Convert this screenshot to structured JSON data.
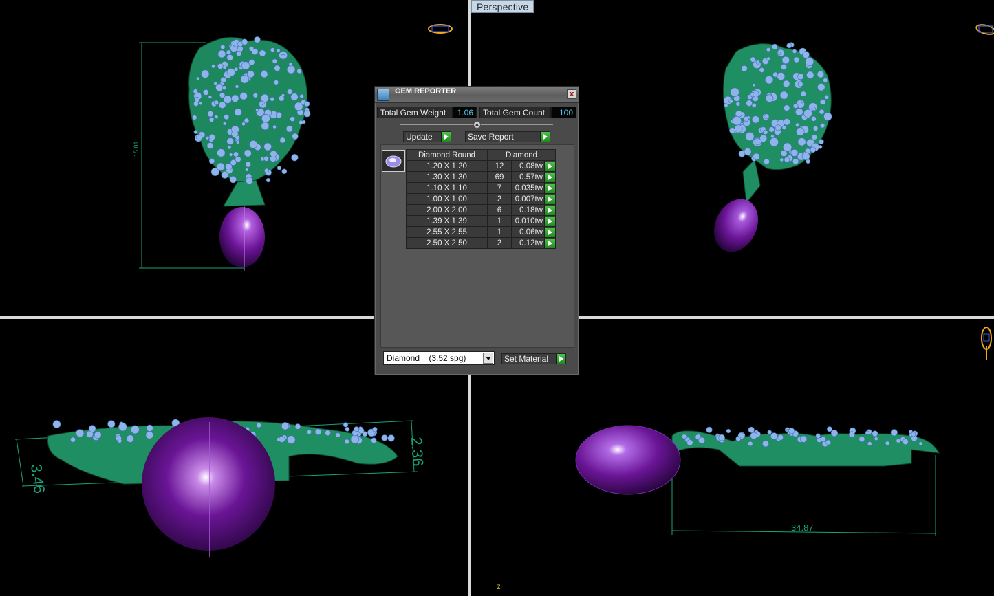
{
  "viewports": {
    "perspective_label": "Perspective",
    "dimensions": {
      "height_front": "15.81",
      "left_height": "3.46",
      "right_height": "2.36",
      "bottom_width": "34.87"
    },
    "axis_label": "Z"
  },
  "gem_reporter": {
    "title": "GEM REPORTER",
    "close": "x",
    "total_weight_label": "Total Gem Weight",
    "total_weight_value": "1.06",
    "total_count_label": "Total Gem Count",
    "total_count_value": "100",
    "update_label": "Update",
    "save_report_label": "Save Report",
    "table": {
      "col_shape": "Diamond Round",
      "col_material": "Diamond",
      "rows": [
        {
          "size": "1.20 X 1.20",
          "count": "12",
          "weight": "0.08tw"
        },
        {
          "size": "1.30 X 1.30",
          "count": "69",
          "weight": "0.57tw"
        },
        {
          "size": "1.10 X 1.10",
          "count": "7",
          "weight": "0.035tw"
        },
        {
          "size": "1.00 X 1.00",
          "count": "2",
          "weight": "0.007tw"
        },
        {
          "size": "2.00 X 2.00",
          "count": "6",
          "weight": "0.18tw"
        },
        {
          "size": "1.39 X 1.39",
          "count": "1",
          "weight": "0.010tw"
        },
        {
          "size": "2.55 X 2.55",
          "count": "1",
          "weight": "0.06tw"
        },
        {
          "size": "2.50 X 2.50",
          "count": "2",
          "weight": "0.12tw"
        }
      ]
    },
    "material_select": "Diamond    (3.52 spg)",
    "set_material_label": "Set Material"
  },
  "colors": {
    "metal": "#1f8f63",
    "gem": "#8fb4ea",
    "drop": "#6a1596",
    "dimension": "#1aa27a",
    "gizmo": "#f0a81c"
  },
  "icons": {
    "gizmo": "view-cube-icon",
    "gem": "diamond-round-icon"
  }
}
